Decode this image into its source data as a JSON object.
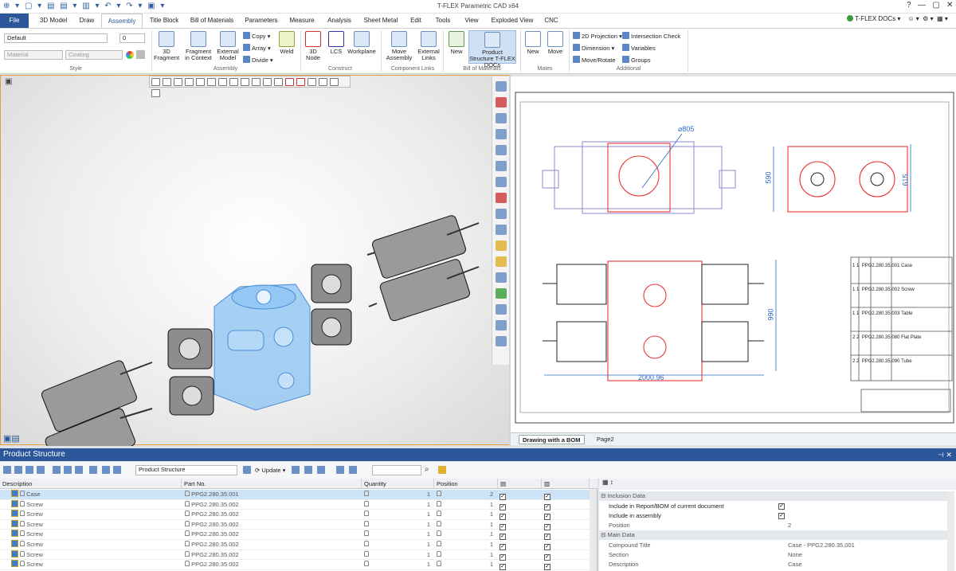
{
  "app": {
    "title": "T-FLEX Parametric CAD x64",
    "brand": "T-FLEX DOCs"
  },
  "tabs": [
    "File",
    "3D Model",
    "Draw",
    "Assembly",
    "Title Block",
    "Bill of Materials",
    "Parameters",
    "Measure",
    "Analysis",
    "Sheet Metal",
    "Edit",
    "Tools",
    "View",
    "Exploded View",
    "CNC"
  ],
  "ribbon": {
    "style": {
      "layer": "Default",
      "width": "0",
      "material": "Material",
      "coating": "Coating",
      "label": "Style"
    },
    "assembly": {
      "fragment3d": "3D Fragment",
      "fragment_context": "Fragment in Context",
      "external_model": "External Model",
      "copy": "Copy",
      "array": "Array",
      "divide": "Divide",
      "weld": "Weld",
      "label": "Assembly"
    },
    "construct": {
      "node3d": "3D Node",
      "lcs": "LCS",
      "workplane": "Workplane",
      "label": "Construct"
    },
    "component_links": {
      "move_assembly": "Move Assembly",
      "external_links": "External Links",
      "label": "Component Links"
    },
    "bom": {
      "new": "New",
      "product_structure": "Product Structure T-FLEX DOCs",
      "label": "Bill of Materials"
    },
    "mates": {
      "new": "New",
      "move": "Move",
      "label": "Mates"
    },
    "additional": {
      "projection": "2D Projection",
      "dimension": "Dimension",
      "move_rotate": "Move/Rotate",
      "intersection": "Intersection Check",
      "variables": "Variables",
      "groups": "Groups",
      "label": "Additional"
    }
  },
  "drawing": {
    "dim_diameter": "⌀805",
    "dim_590": "590",
    "dim_615": "615",
    "dim_990": "990",
    "dim_2000": "2000.96",
    "bom": [
      {
        "pos": "1",
        "code": "PPG2.280.35.001",
        "name": "Case",
        "q": "1"
      },
      {
        "pos": "1",
        "code": "PPG2.280.35.002",
        "name": "Screw",
        "q": "1"
      },
      {
        "pos": "1",
        "code": "PPG2.280.35.003",
        "name": "Table",
        "q": "1"
      },
      {
        "pos": "2",
        "code": "PPG2.280.35.080",
        "name": "Flat Plate",
        "q": "2"
      },
      {
        "pos": "2",
        "code": "PPG2.280.35.090",
        "name": "Tube",
        "q": "2"
      }
    ]
  },
  "doc_tabs": [
    "Drawing with a BOM",
    "Page2"
  ],
  "product_structure": {
    "title": "Product Structure",
    "combo": "Product Structure",
    "update": "Update",
    "columns": [
      "Description",
      "Part No.",
      "Quantity",
      "Position"
    ],
    "rows": [
      {
        "desc": "Case",
        "part": "PPG2.280.35.001",
        "qty": "1",
        "pos": "2"
      },
      {
        "desc": "Screw",
        "part": "PPG2.280.35.002",
        "qty": "1",
        "pos": "1"
      },
      {
        "desc": "Screw",
        "part": "PPG2.280.35.002",
        "qty": "1",
        "pos": "1"
      },
      {
        "desc": "Screw",
        "part": "PPG2.280.35.002",
        "qty": "1",
        "pos": "1"
      },
      {
        "desc": "Screw",
        "part": "PPG2.280.35.002",
        "qty": "1",
        "pos": "1"
      },
      {
        "desc": "Screw",
        "part": "PPG2.280.35.002",
        "qty": "1",
        "pos": "1"
      },
      {
        "desc": "Screw",
        "part": "PPG2.280.35.002",
        "qty": "1",
        "pos": "1"
      },
      {
        "desc": "Screw",
        "part": "PPG2.280.35.002",
        "qty": "1",
        "pos": "1"
      }
    ]
  },
  "properties": {
    "sec1": "Inclusion Data",
    "incl_report": "Include in Report/BOM of current document",
    "incl_assembly": "Include in assembly",
    "position_label": "Position",
    "position_value": "2",
    "sec2": "Main Data",
    "compound_label": "Compound Title",
    "compound_value": "Case - PPG2.280.35.001",
    "section_label": "Section",
    "section_value": "None",
    "desc_label": "Description",
    "desc_value": "Case"
  }
}
